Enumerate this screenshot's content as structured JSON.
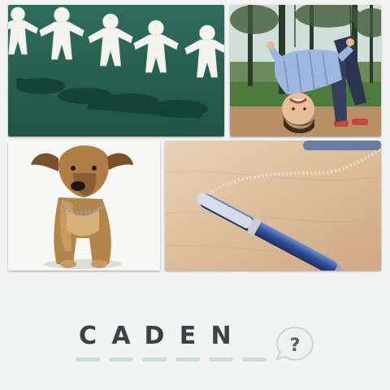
{
  "puzzle": {
    "pictures": [
      {
        "subject": "paper-doll-chain"
      },
      {
        "subject": "boy-on-swing"
      },
      {
        "subject": "dog"
      },
      {
        "subject": "pen"
      }
    ],
    "answer_letters": [
      "C",
      "A",
      "D",
      "E",
      "N",
      ""
    ],
    "hint_symbol": "?"
  },
  "colors": {
    "background": "#f2f3f3",
    "letter": "#3d4143",
    "slot_line": "#c8ddd7",
    "hint_fill": "#eef3f1",
    "hint_stroke": "#c9d6d1",
    "hint_symbol": "#586064"
  },
  "icons": {
    "hint": "question-bubble-icon"
  }
}
